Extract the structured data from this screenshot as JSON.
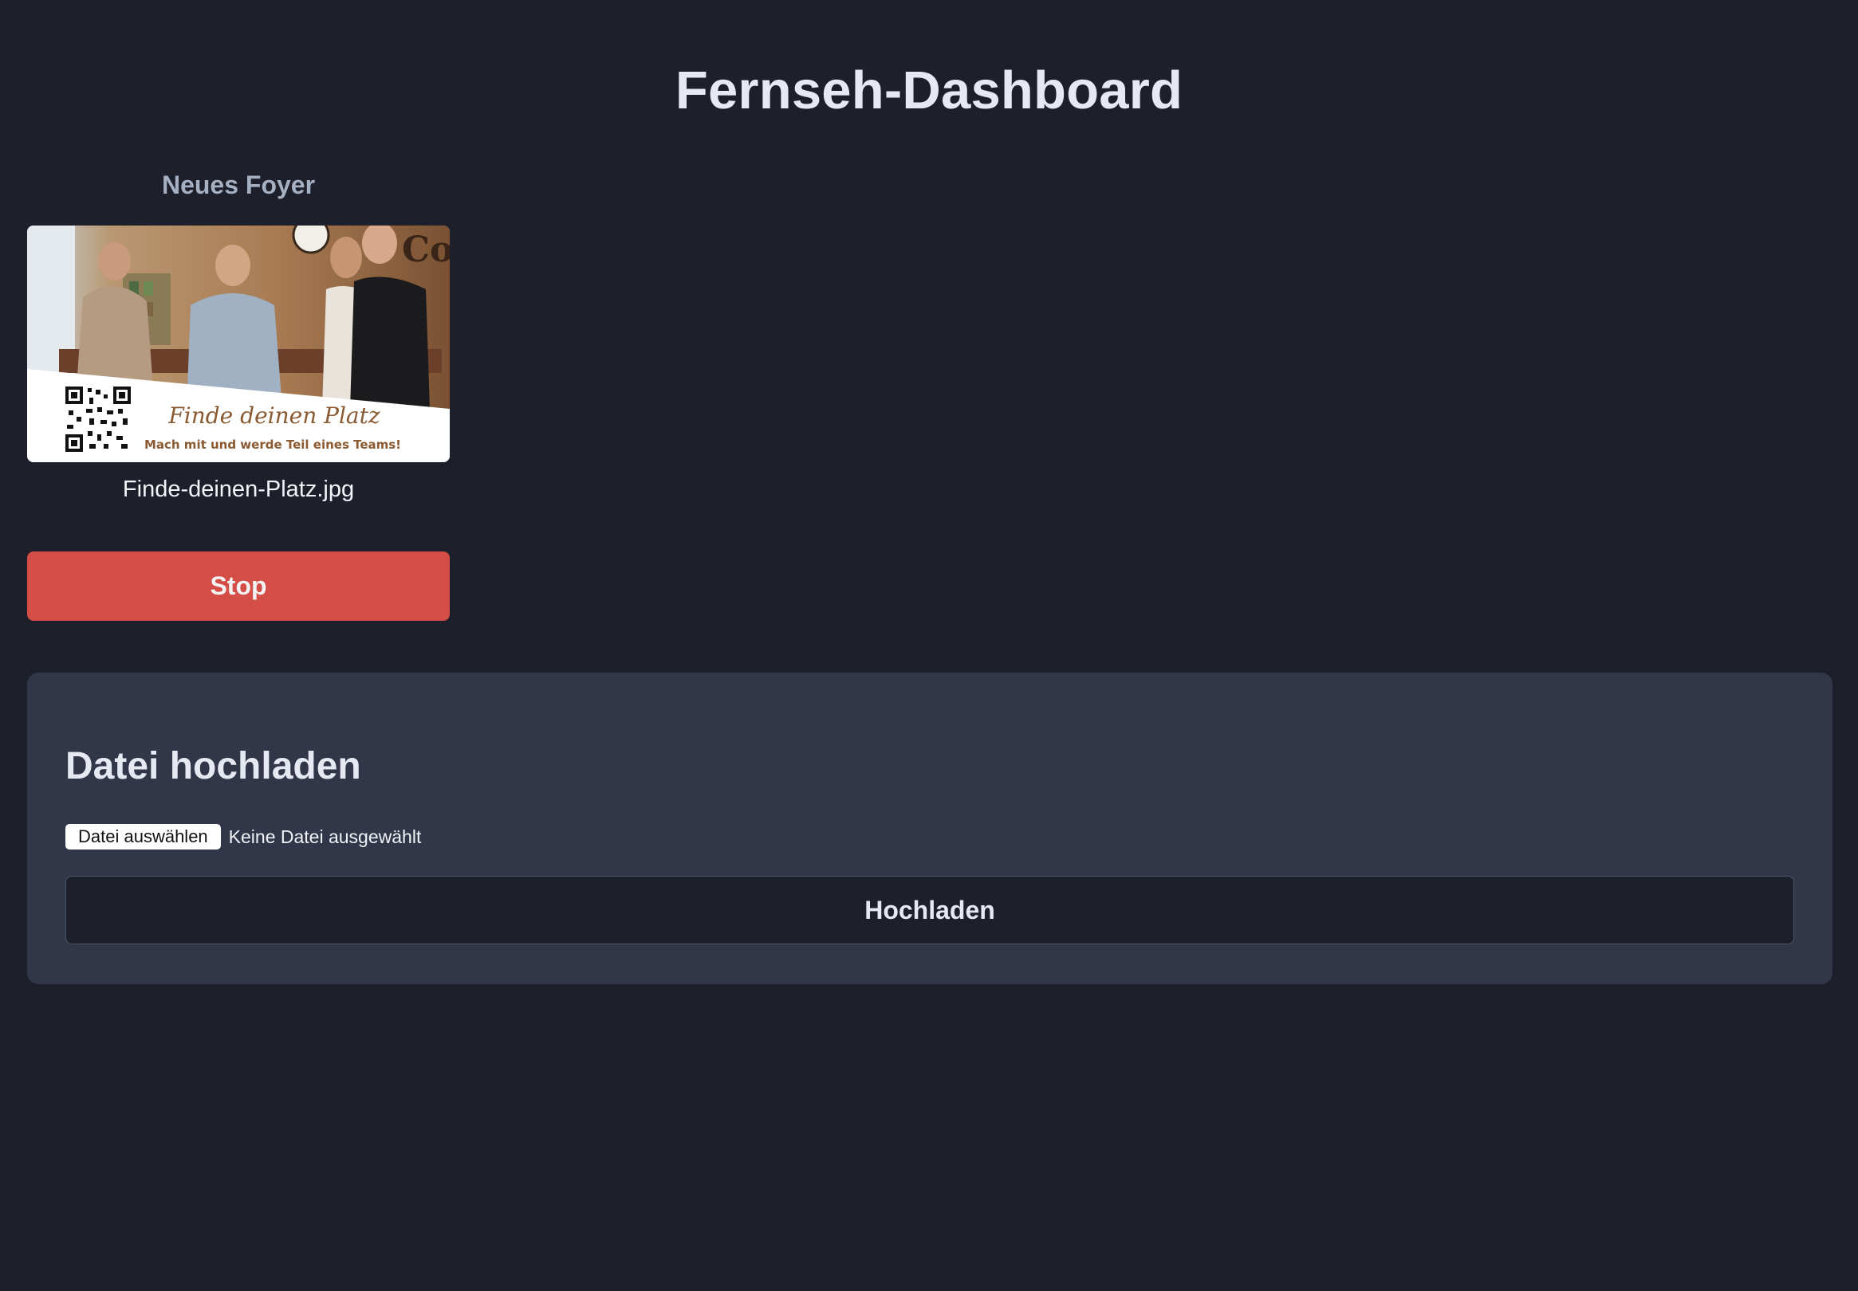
{
  "page": {
    "title": "Fernseh-Dashboard"
  },
  "tv": {
    "name": "Neues Foyer",
    "current_file": "Finde-deinen-Platz.jpg",
    "stop_label": "Stop",
    "preview": {
      "headline": "Finde deinen Platz",
      "tagline": "Mach mit und werde Teil eines Teams!"
    }
  },
  "upload": {
    "title": "Datei hochladen",
    "choose_label": "Datei auswählen",
    "no_file_text": "Keine Datei ausgewählt",
    "submit_label": "Hochladen"
  },
  "colors": {
    "background": "#1d202b",
    "panel": "#313748",
    "stop": "#d44d47",
    "heading": "#e6e9f2",
    "muted": "#a6b0c3"
  }
}
